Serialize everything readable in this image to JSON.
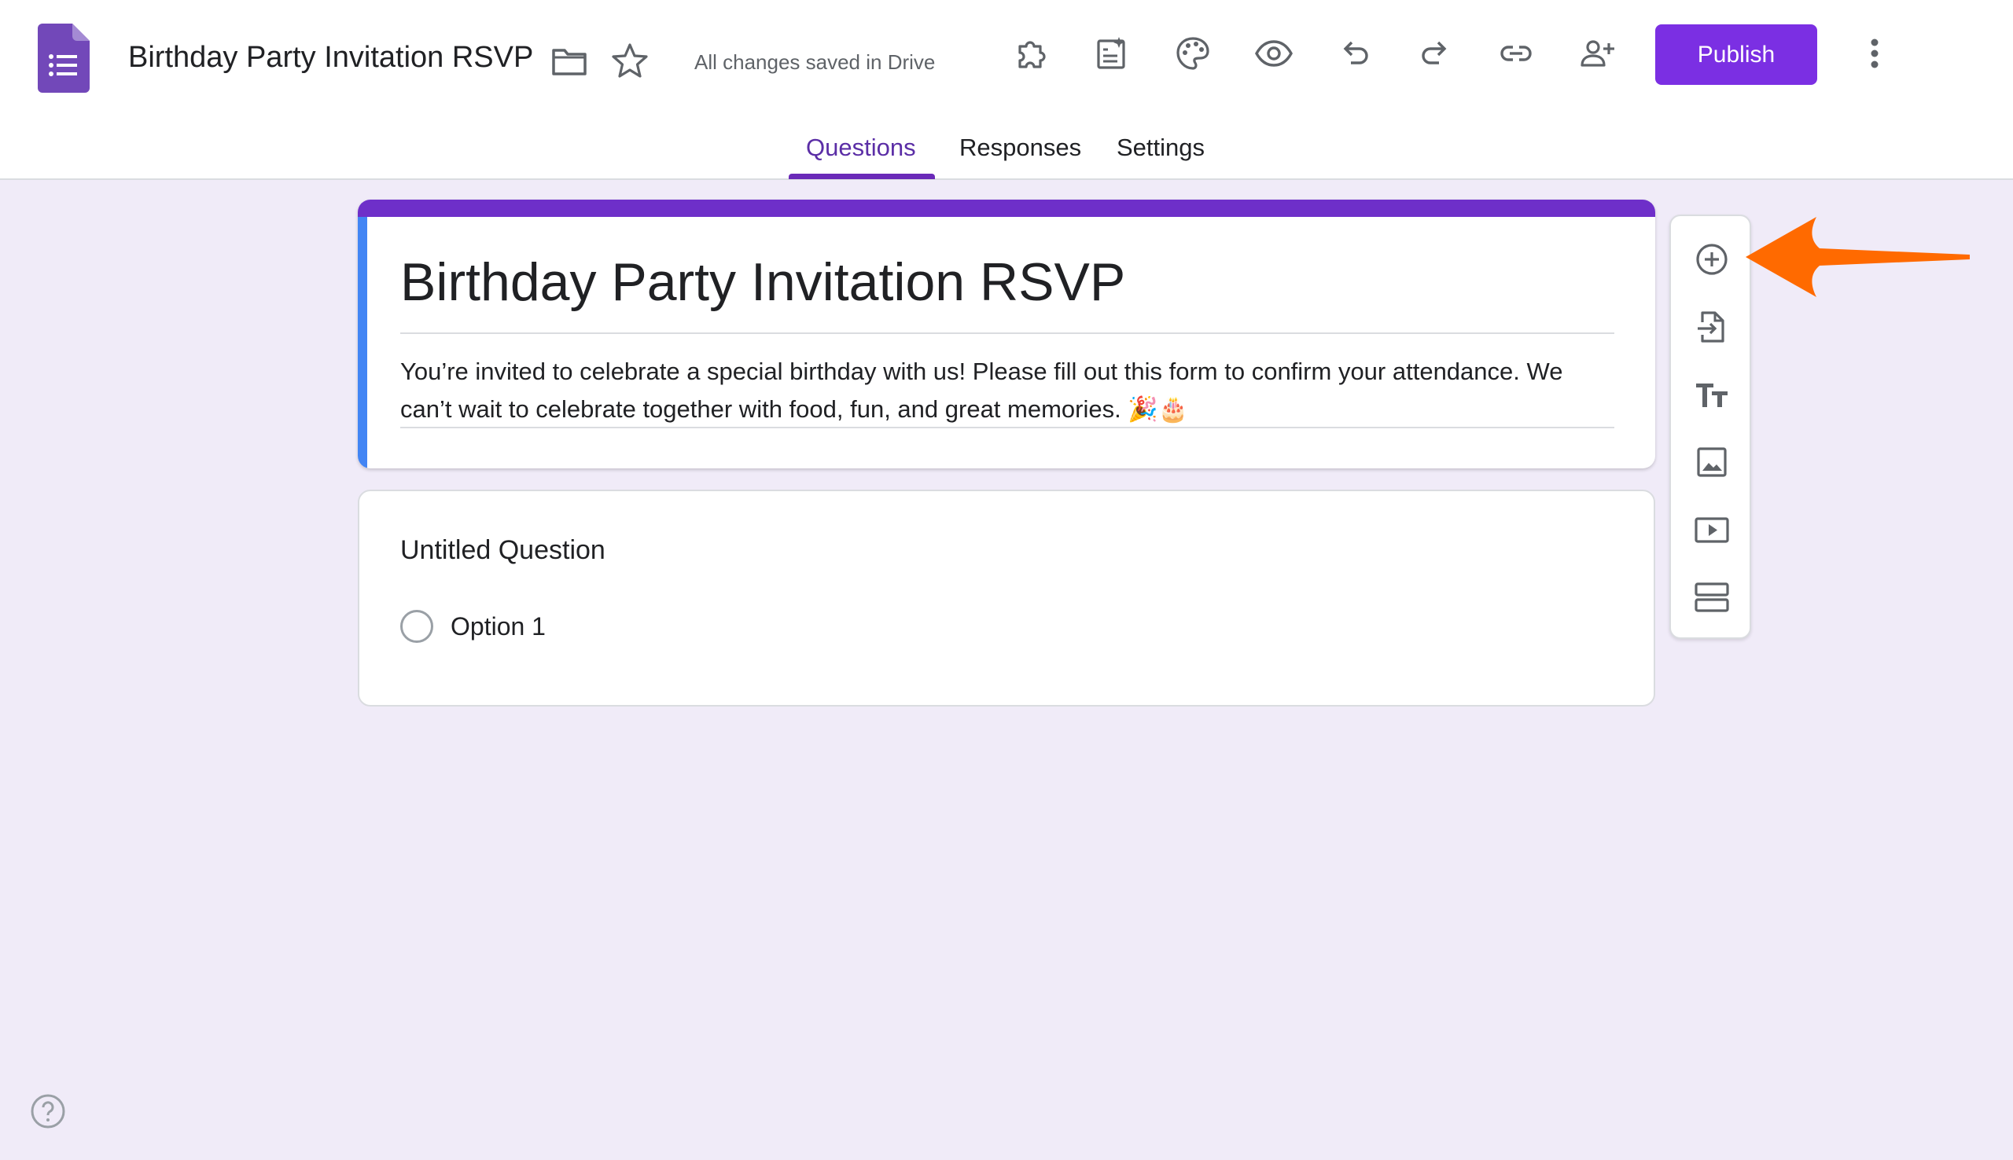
{
  "header": {
    "doc_title": "Birthday Party Invitation RSVP",
    "save_status": "All changes saved in Drive",
    "publish_label": "Publish",
    "icons": {
      "logo": "google-forms-icon",
      "folder": "folder-icon",
      "star": "star-icon",
      "toolbar": [
        "add-ons-icon",
        "customize-form-icon",
        "theme-palette-icon",
        "preview-eye-icon",
        "undo-icon",
        "redo-icon",
        "copy-link-icon",
        "add-collaborator-icon",
        "more-vert-icon"
      ]
    }
  },
  "tabs": [
    {
      "label": "Questions",
      "active": true
    },
    {
      "label": "Responses",
      "active": false
    },
    {
      "label": "Settings",
      "active": false
    }
  ],
  "form": {
    "title": "Birthday Party Invitation RSVP",
    "description": "You’re invited to celebrate a special birthday with us! Please fill out this form to confirm your attendance. We can’t wait to celebrate together with food, fun, and great memories. 🎉🎂"
  },
  "question": {
    "title": "Untitled Question",
    "options": [
      "Option 1"
    ]
  },
  "side_toolbar": [
    "add-question-icon",
    "import-questions-icon",
    "add-title-text-icon",
    "add-image-icon",
    "add-video-icon",
    "add-section-icon"
  ],
  "colors": {
    "background": "#f0ebf8",
    "publish": "#7b2fe3",
    "form_accent": "#6e2fc9",
    "left_accent": "#4285f4",
    "active_tab": "#5b2ea6",
    "annotation_arrow": "#ff6a00"
  }
}
